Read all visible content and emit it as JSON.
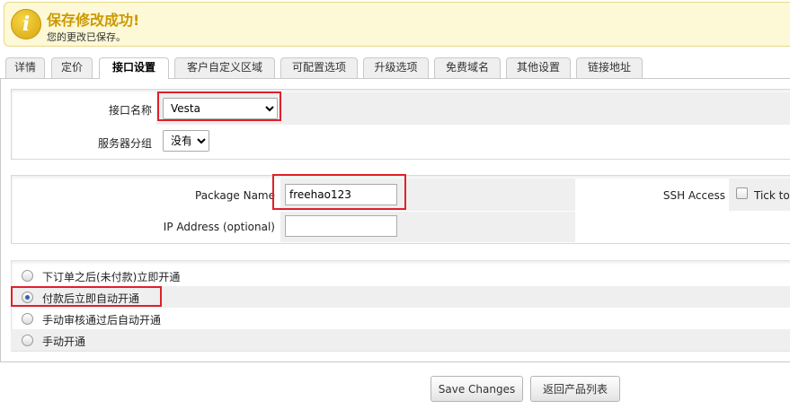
{
  "alert": {
    "icon": "info-icon",
    "icon_glyph": "i",
    "title": "保存修改成功!",
    "text": "您的更改已保存。"
  },
  "tabs": [
    {
      "label": "详情"
    },
    {
      "label": "定价"
    },
    {
      "label": "接口设置",
      "active": true
    },
    {
      "label": "客户自定义区域"
    },
    {
      "label": "可配置选项"
    },
    {
      "label": "升级选项"
    },
    {
      "label": "免费域名"
    },
    {
      "label": "其他设置"
    },
    {
      "label": "链接地址"
    }
  ],
  "module": {
    "name_label": "接口名称",
    "name_value": "Vesta",
    "server_group_label": "服务器分组",
    "server_group_value": "没有"
  },
  "config": {
    "package_label": "Package Name",
    "package_value": "freehao123",
    "ip_label": "IP Address (optional)",
    "ip_value": "",
    "ssh_label": "SSH Access",
    "ssh_checkbox_label": "Tick to"
  },
  "setup_options": [
    {
      "label": "下订单之后(未付款)立即开通",
      "checked": false
    },
    {
      "label": "付款后立即自动开通",
      "checked": true
    },
    {
      "label": "手动审核通过后自动开通",
      "checked": false
    },
    {
      "label": "手动开通",
      "checked": false
    }
  ],
  "buttons": {
    "save": "Save Changes",
    "back": "返回产品列表"
  },
  "highlight_color": "#e0202a"
}
